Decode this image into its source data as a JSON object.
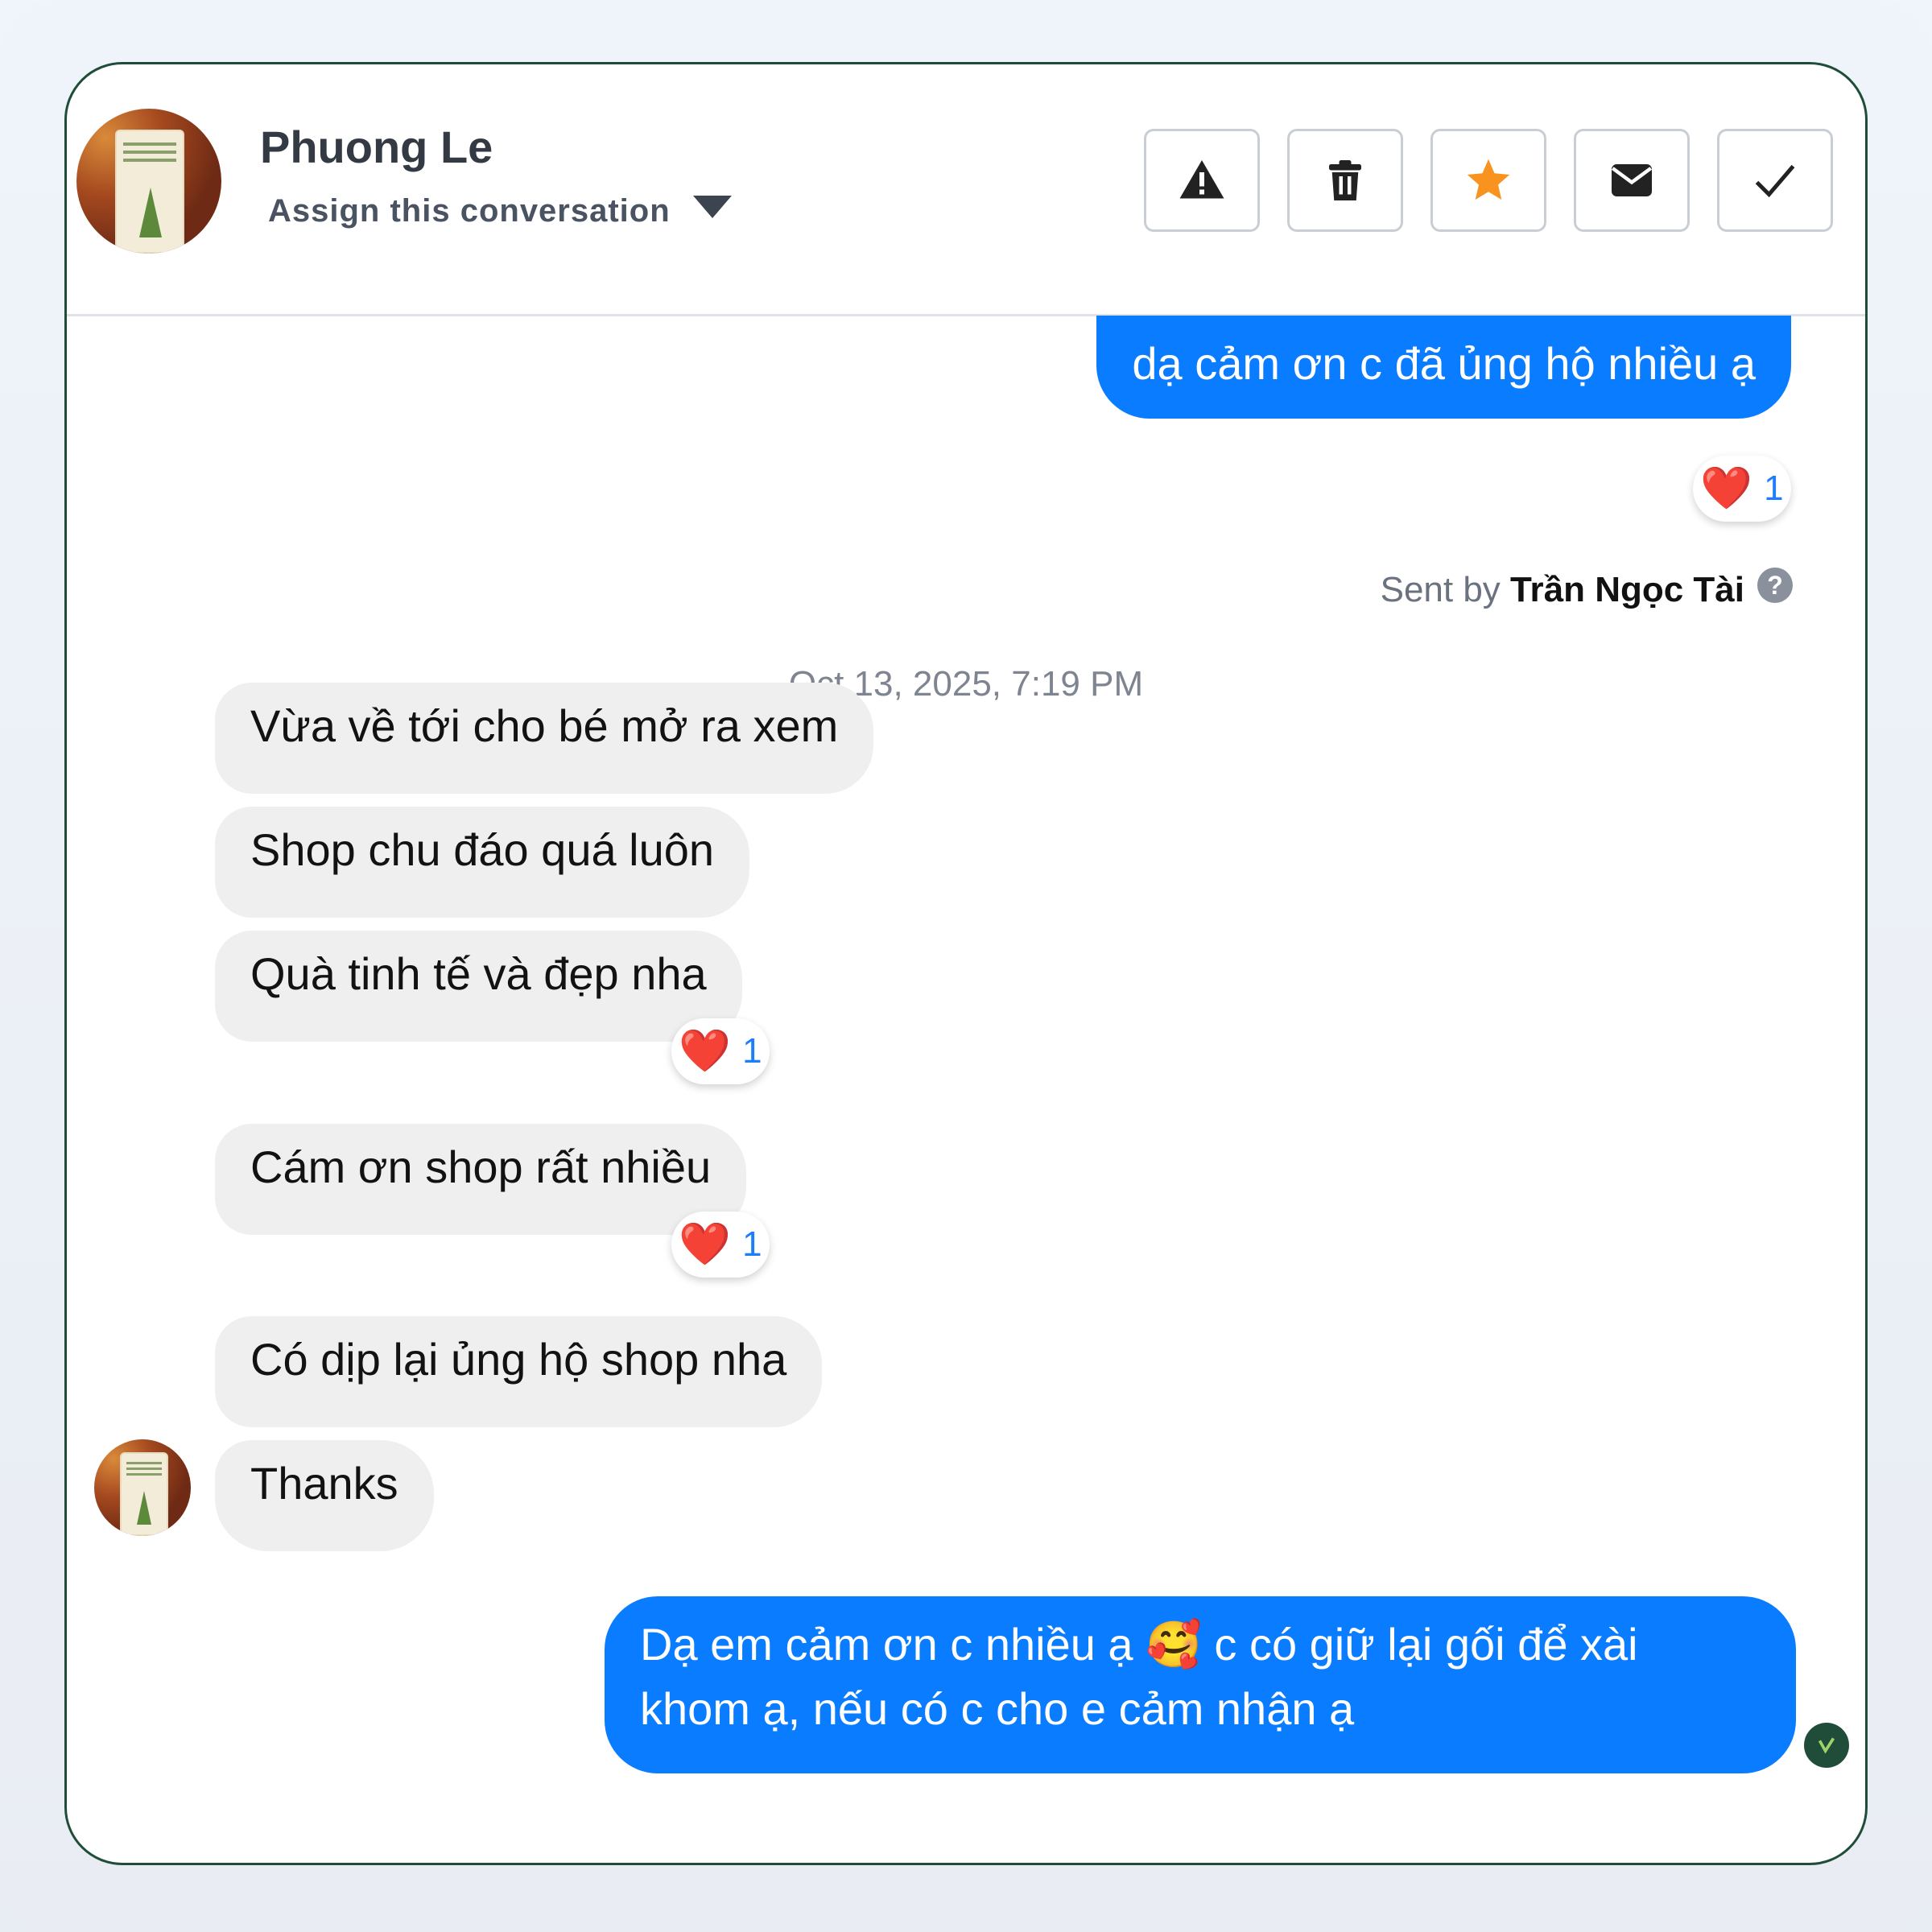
{
  "header": {
    "contact_name": "Phuong Le",
    "assign_label": "Assign this conversation",
    "actions": [
      "warning",
      "delete",
      "star",
      "mark-unread",
      "done"
    ]
  },
  "colors": {
    "card_border": "#1f4d3a",
    "outgoing_bubble": "#0a7cff",
    "incoming_bubble": "#efefef",
    "star": "#f7931e",
    "reaction_count": "#1e7cff"
  },
  "messages": {
    "outgoing_first": "dạ cảm ơn c đã ủng hộ nhiều ạ",
    "outgoing_first_reaction": {
      "emoji": "❤️",
      "count": "1"
    },
    "sent_by_prefix": "Sent by",
    "sent_by_name": "Trần Ngọc Tài",
    "help_glyph": "?",
    "timestamp": "Oct 13, 2025, 7:19 PM",
    "incoming": [
      {
        "text": "Vừa về tới cho bé mở ra xem"
      },
      {
        "text": "Shop chu đáo quá luôn"
      },
      {
        "text": "Quà tinh tế và đẹp nha",
        "reaction": {
          "emoji": "❤️",
          "count": "1"
        }
      },
      {
        "text": "Cám ơn shop rất nhiều",
        "reaction": {
          "emoji": "❤️",
          "count": "1"
        }
      },
      {
        "text": "Có dịp lại ủng hộ shop nha"
      },
      {
        "text": "Thanks"
      }
    ],
    "outgoing_last_line1": "Dạ em cảm ơn c nhiều ạ 🥰 c có giữ lại gối để xài",
    "outgoing_last_line2": "khom ạ, nếu có c cho e cảm nhận ạ"
  }
}
